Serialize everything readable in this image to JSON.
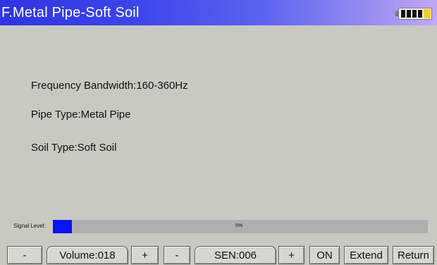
{
  "header": {
    "title": "F.Metal Pipe-Soft Soil",
    "battery_level": "4 of 4 bars, charging"
  },
  "info": {
    "frequency_bandwidth": "Frequency Bandwidth:160-360Hz",
    "pipe_type": "Pipe Type:Metal Pipe",
    "soil_type": "Soil Type:Soft Soil"
  },
  "signal": {
    "label": "Signal Level:",
    "percent_text": "5%",
    "level_percent": 5
  },
  "toolbar": {
    "volume_minus": "-",
    "volume": "Volume:018",
    "volume_plus": "+",
    "sen_minus": "-",
    "sen": "SEN:006",
    "sen_plus": "+",
    "on": "ON",
    "extend": "Extend",
    "return": "Return"
  },
  "colors": {
    "title_gradient_start": "#2f35e0",
    "title_gradient_end": "#c1a8f4",
    "background": "#c9c9c4",
    "signal_fill": "#0a14f0",
    "signal_track": "#aeaeae",
    "battery_charge": "#f0d020"
  }
}
